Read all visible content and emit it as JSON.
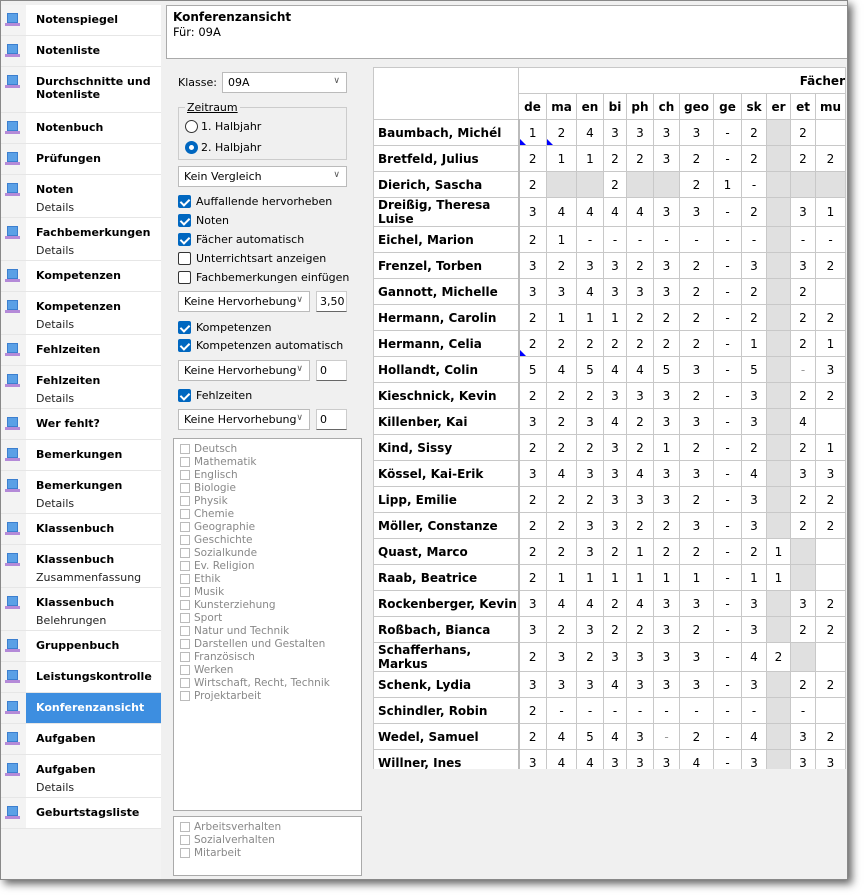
{
  "sidebar": {
    "items": [
      {
        "label": "Notenspiegel",
        "sub": ""
      },
      {
        "label": "Notenliste",
        "sub": ""
      },
      {
        "label": "Durchschnitte und Notenliste",
        "sub": ""
      },
      {
        "label": "Notenbuch",
        "sub": ""
      },
      {
        "label": "Prüfungen",
        "sub": ""
      },
      {
        "label": "Noten",
        "sub": "Details"
      },
      {
        "label": "Fachbemerkungen",
        "sub": "Details"
      },
      {
        "label": "Kompetenzen",
        "sub": ""
      },
      {
        "label": "Kompetenzen",
        "sub": "Details"
      },
      {
        "label": "Fehlzeiten",
        "sub": ""
      },
      {
        "label": "Fehlzeiten",
        "sub": "Details"
      },
      {
        "label": "Wer fehlt?",
        "sub": ""
      },
      {
        "label": "Bemerkungen",
        "sub": ""
      },
      {
        "label": "Bemerkungen",
        "sub": "Details"
      },
      {
        "label": "Klassenbuch",
        "sub": ""
      },
      {
        "label": "Klassenbuch",
        "sub": "Zusammenfassung"
      },
      {
        "label": "Klassenbuch",
        "sub": "Belehrungen"
      },
      {
        "label": "Gruppenbuch",
        "sub": ""
      },
      {
        "label": "Leistungskontrolle",
        "sub": ""
      },
      {
        "label": "Konferenzansicht",
        "sub": "",
        "selected": true
      },
      {
        "label": "Aufgaben",
        "sub": ""
      },
      {
        "label": "Aufgaben",
        "sub": "Details"
      },
      {
        "label": "Geburtstagsliste",
        "sub": ""
      }
    ],
    "icon": "report-icon",
    "selected_color": "#3d8ee0"
  },
  "header": {
    "title": "Konferenzansicht",
    "subtitle": "Für: 09A"
  },
  "panel": {
    "klasse_label": "Klasse:",
    "klasse_value": "09A",
    "zeitraum_label": "Zeitraum",
    "radio1": "1. Halbjahr",
    "radio2": "2. Halbjahr",
    "radio_selected": "2. Halbjahr",
    "vergleich": "Kein Vergleich",
    "checks1": [
      {
        "label": "Auffallende hervorheben",
        "checked": true
      },
      {
        "label": "Noten",
        "checked": true
      },
      {
        "label": "Fächer automatisch",
        "checked": true
      },
      {
        "label": "Unterrichtsart anzeigen",
        "checked": false
      },
      {
        "label": "Fachbemerkungen einfügen",
        "checked": false
      }
    ],
    "hervor1": "Keine Hervorhebung",
    "hervor1_value": "3,50",
    "checks2": [
      {
        "label": "Kompetenzen",
        "checked": true
      },
      {
        "label": "Kompetenzen automatisch",
        "checked": true
      }
    ],
    "hervor2": "Keine Hervorhebung",
    "hervor2_value": "0",
    "check3": {
      "label": "Fehlzeiten",
      "checked": true
    },
    "hervor3": "Keine Hervorhebung",
    "hervor3_value": "0",
    "subjects": [
      "Deutsch",
      "Mathematik",
      "Englisch",
      "Biologie",
      "Physik",
      "Chemie",
      "Geographie",
      "Geschichte",
      "Sozialkunde",
      "Ev. Religion",
      "Ethik",
      "Musik",
      "Kunsterziehung",
      "Sport",
      "Natur und Technik",
      "Darstellen und Gestalten",
      "Französisch",
      "Werken",
      "Wirtschaft, Recht, Technik",
      "Projektarbeit"
    ],
    "behaviour": [
      "Arbeitsverhalten",
      "Sozialverhalten",
      "Mitarbeit"
    ]
  },
  "grid": {
    "group_header": "Fächer",
    "columns": [
      "de",
      "ma",
      "en",
      "bi",
      "ph",
      "ch",
      "geo",
      "ge",
      "sk",
      "er",
      "et",
      "mu"
    ],
    "rows": [
      {
        "name": "Baumbach, Michél",
        "v": [
          "1",
          "2",
          "4",
          "3",
          "3",
          "3",
          "3",
          "-",
          "2",
          null,
          "2",
          ""
        ],
        "marks": [
          0,
          1
        ]
      },
      {
        "name": "Bretfeld, Julius",
        "v": [
          "2",
          "1",
          "1",
          "2",
          "2",
          "3",
          "2",
          "-",
          "2",
          null,
          "2",
          "2"
        ]
      },
      {
        "name": "Dierich, Sascha",
        "v": [
          "2",
          null,
          null,
          "2",
          null,
          null,
          "2",
          "1",
          "-",
          null,
          null,
          null
        ]
      },
      {
        "name": "Dreißig, Theresa Luise",
        "v": [
          "3",
          "4",
          "4",
          "4",
          "4",
          "3",
          "3",
          "-",
          "2",
          null,
          "3",
          "1"
        ]
      },
      {
        "name": "Eichel, Marion",
        "v": [
          "2",
          "1",
          "-",
          "-",
          "-",
          "-",
          "-",
          "-",
          "-",
          null,
          "-",
          "-"
        ]
      },
      {
        "name": "Frenzel, Torben",
        "v": [
          "3",
          "2",
          "3",
          "3",
          "2",
          "3",
          "2",
          "-",
          "3",
          null,
          "3",
          "2"
        ]
      },
      {
        "name": "Gannott, Michelle",
        "v": [
          "3",
          "3",
          "4",
          "3",
          "3",
          "3",
          "2",
          "-",
          "2",
          null,
          "2",
          ""
        ]
      },
      {
        "name": "Hermann, Carolin",
        "v": [
          "2",
          "1",
          "1",
          "1",
          "2",
          "2",
          "2",
          "-",
          "2",
          null,
          "2",
          "2"
        ]
      },
      {
        "name": "Hermann, Celia",
        "v": [
          "2",
          "2",
          "2",
          "2",
          "2",
          "2",
          "2",
          "-",
          "1",
          null,
          "2",
          "1"
        ],
        "marks": [
          0
        ]
      },
      {
        "name": "Hollandt, Colin",
        "v": [
          "5",
          "4",
          "5",
          "4",
          "4",
          "5",
          "3",
          "-",
          "5",
          null,
          "-",
          "3"
        ]
      },
      {
        "name": "Kieschnick, Kevin",
        "v": [
          "2",
          "2",
          "2",
          "3",
          "3",
          "3",
          "2",
          "-",
          "3",
          null,
          "2",
          "2"
        ]
      },
      {
        "name": "Killenber, Kai",
        "v": [
          "3",
          "2",
          "3",
          "4",
          "2",
          "3",
          "3",
          "-",
          "3",
          null,
          "4",
          ""
        ]
      },
      {
        "name": "Kind, Sissy",
        "v": [
          "2",
          "2",
          "2",
          "3",
          "2",
          "1",
          "2",
          "-",
          "2",
          null,
          "2",
          "1"
        ]
      },
      {
        "name": "Kössel, Kai-Erik",
        "v": [
          "3",
          "4",
          "3",
          "3",
          "4",
          "3",
          "3",
          "-",
          "4",
          null,
          "3",
          "3"
        ]
      },
      {
        "name": "Lipp, Emilie",
        "v": [
          "2",
          "2",
          "2",
          "3",
          "3",
          "3",
          "2",
          "-",
          "3",
          null,
          "2",
          "2"
        ]
      },
      {
        "name": "Möller, Constanze",
        "v": [
          "2",
          "2",
          "3",
          "3",
          "2",
          "2",
          "3",
          "-",
          "3",
          null,
          "2",
          "2"
        ]
      },
      {
        "name": "Quast, Marco",
        "v": [
          "2",
          "2",
          "3",
          "2",
          "1",
          "2",
          "2",
          "-",
          "2",
          "1",
          null,
          ""
        ]
      },
      {
        "name": "Raab, Beatrice",
        "v": [
          "2",
          "1",
          "1",
          "1",
          "1",
          "1",
          "1",
          "-",
          "1",
          "1",
          null,
          ""
        ]
      },
      {
        "name": "Rockenberger, Kevin",
        "v": [
          "3",
          "4",
          "4",
          "2",
          "4",
          "3",
          "3",
          "-",
          "3",
          null,
          "3",
          "2"
        ]
      },
      {
        "name": "Roßbach, Bianca",
        "v": [
          "3",
          "2",
          "3",
          "2",
          "2",
          "3",
          "2",
          "-",
          "3",
          null,
          "2",
          "2"
        ]
      },
      {
        "name": "Schafferhans, Markus",
        "v": [
          "2",
          "3",
          "2",
          "3",
          "3",
          "3",
          "3",
          "-",
          "4",
          "2",
          null,
          ""
        ]
      },
      {
        "name": "Schenk, Lydia",
        "v": [
          "3",
          "3",
          "3",
          "4",
          "3",
          "3",
          "3",
          "-",
          "3",
          null,
          "2",
          "2"
        ]
      },
      {
        "name": "Schindler, Robin",
        "v": [
          "2",
          "-",
          "-",
          "-",
          "-",
          "-",
          "-",
          "-",
          "-",
          null,
          "-",
          ""
        ]
      },
      {
        "name": "Wedel, Samuel",
        "v": [
          "2",
          "4",
          "5",
          "4",
          "3",
          "-",
          "2",
          "-",
          "4",
          null,
          "3",
          "2"
        ]
      },
      {
        "name": "Willner, Ines",
        "v": [
          "3",
          "4",
          "4",
          "3",
          "3",
          "3",
          "4",
          "-",
          "3",
          null,
          "3",
          "3"
        ]
      }
    ]
  }
}
